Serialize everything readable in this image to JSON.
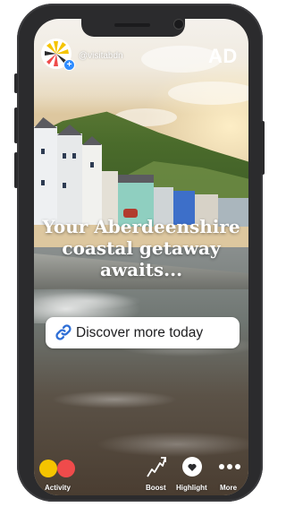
{
  "account": {
    "handle": "@visitabdn",
    "badge_icon": "plus-icon"
  },
  "ad_label": "AD",
  "headline": {
    "line1": "Your Aberdeenshire",
    "line2": "coastal getaway",
    "line3": "awaits..."
  },
  "cta": {
    "label": "Discover more today",
    "icon": "link-icon",
    "icon_color": "#2f6fd6"
  },
  "toolbar": {
    "activity_label": "Activity",
    "boost_label": "Boost",
    "highlight_label": "Highlight",
    "more_label": "More"
  },
  "colors": {
    "activity_dot_yellow": "#f5c400",
    "activity_dot_red": "#ef4b4b"
  }
}
